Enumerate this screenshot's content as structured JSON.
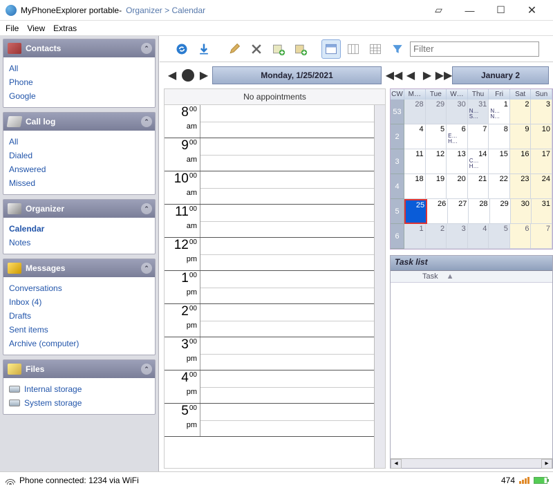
{
  "title": {
    "app": "MyPhoneExplorer portable",
    "sep": " - ",
    "breadcrumb": "Organizer > Calendar"
  },
  "menubar": [
    "File",
    "View",
    "Extras"
  ],
  "sidebar": {
    "panels": [
      {
        "title": "Contacts",
        "items": [
          "All",
          "Phone",
          "Google"
        ]
      },
      {
        "title": "Call log",
        "items": [
          "All",
          "Dialed",
          "Answered",
          "Missed"
        ]
      },
      {
        "title": "Organizer",
        "items": [
          "Calendar",
          "Notes"
        ],
        "active": "Calendar"
      },
      {
        "title": "Messages",
        "items": [
          "Conversations",
          "Inbox (4)",
          "Drafts",
          "Sent items",
          "Archive (computer)"
        ]
      },
      {
        "title": "Files",
        "items": [
          "Internal storage",
          "System storage"
        ],
        "driveIcon": true
      }
    ]
  },
  "toolbar": {
    "filter_placeholder": "Filter"
  },
  "day": {
    "label": "Monday, 1/25/2021",
    "noapp": "No appointments",
    "hours": [
      {
        "h": "8",
        "m": "00",
        "ap": "am"
      },
      {
        "h": "9",
        "m": "00",
        "ap": "am"
      },
      {
        "h": "10",
        "m": "00",
        "ap": "am"
      },
      {
        "h": "11",
        "m": "00",
        "ap": "am"
      },
      {
        "h": "12",
        "m": "00",
        "ap": "pm"
      },
      {
        "h": "1",
        "m": "00",
        "ap": "pm"
      },
      {
        "h": "2",
        "m": "00",
        "ap": "pm"
      },
      {
        "h": "3",
        "m": "00",
        "ap": "pm"
      },
      {
        "h": "4",
        "m": "00",
        "ap": "pm"
      },
      {
        "h": "5",
        "m": "00",
        "ap": "pm"
      }
    ]
  },
  "month": {
    "label": "January 2",
    "cw_label": "CW",
    "dow": [
      "M…",
      "Tue",
      "W…",
      "Thu",
      "Fri",
      "Sat",
      "Sun"
    ],
    "weeks": [
      {
        "wk": "53",
        "cells": [
          {
            "d": "28",
            "dim": true
          },
          {
            "d": "29",
            "dim": true
          },
          {
            "d": "30",
            "dim": true
          },
          {
            "d": "31",
            "dim": true,
            "ev": "N… S…"
          },
          {
            "d": "1",
            "ev": "N… N…"
          },
          {
            "d": "2",
            "we": true
          },
          {
            "d": "3",
            "we": true
          }
        ]
      },
      {
        "wk": "2",
        "cells": [
          {
            "d": "4"
          },
          {
            "d": "5"
          },
          {
            "d": "6",
            "ev": "E… H…"
          },
          {
            "d": "7"
          },
          {
            "d": "8"
          },
          {
            "d": "9",
            "we": true
          },
          {
            "d": "10",
            "we": true
          }
        ]
      },
      {
        "wk": "3",
        "cells": [
          {
            "d": "11"
          },
          {
            "d": "12"
          },
          {
            "d": "13"
          },
          {
            "d": "14",
            "ev": "C… H…"
          },
          {
            "d": "15"
          },
          {
            "d": "16",
            "we": true
          },
          {
            "d": "17",
            "we": true
          }
        ]
      },
      {
        "wk": "4",
        "cells": [
          {
            "d": "18"
          },
          {
            "d": "19"
          },
          {
            "d": "20"
          },
          {
            "d": "21"
          },
          {
            "d": "22"
          },
          {
            "d": "23",
            "we": true
          },
          {
            "d": "24",
            "we": true
          }
        ]
      },
      {
        "wk": "5",
        "cells": [
          {
            "d": "25",
            "today": true
          },
          {
            "d": "26"
          },
          {
            "d": "27"
          },
          {
            "d": "28"
          },
          {
            "d": "29"
          },
          {
            "d": "30",
            "we": true
          },
          {
            "d": "31",
            "we": true
          }
        ]
      },
      {
        "wk": "6",
        "cells": [
          {
            "d": "1",
            "dim": true
          },
          {
            "d": "2",
            "dim": true
          },
          {
            "d": "3",
            "dim": true
          },
          {
            "d": "4",
            "dim": true
          },
          {
            "d": "5",
            "dim": true
          },
          {
            "d": "6",
            "dim": true,
            "we": true
          },
          {
            "d": "7",
            "dim": true,
            "we": true
          }
        ]
      }
    ]
  },
  "tasklist": {
    "header": "Task list",
    "col": "Task"
  },
  "status": {
    "text": "Phone connected: 1234 via WiFi",
    "count": "474"
  }
}
